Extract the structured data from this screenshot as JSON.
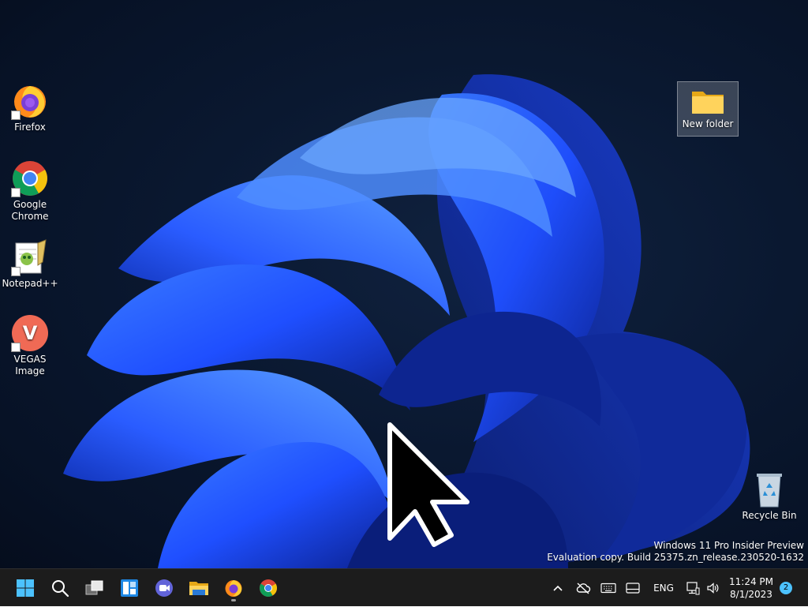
{
  "desktop": {
    "icons": [
      {
        "label": "Firefox",
        "icon": "firefox-icon"
      },
      {
        "label": "Google Chrome",
        "icon": "chrome-icon"
      },
      {
        "label": "Notepad++",
        "icon": "notepadpp-icon"
      },
      {
        "label": "VEGAS Image",
        "icon": "vegas-image-icon"
      },
      {
        "label": "New folder",
        "icon": "folder-icon"
      },
      {
        "label": "Recycle Bin",
        "icon": "recycle-bin-icon"
      }
    ],
    "watermark": {
      "line1": "Windows 11 Pro Insider Preview",
      "line2": "Evaluation copy. Build 25375.zn_release.230520-1632"
    }
  },
  "taskbar": {
    "apps": [
      {
        "name": "Start",
        "icon": "windows-start-icon"
      },
      {
        "name": "Search",
        "icon": "search-icon"
      },
      {
        "name": "Task View",
        "icon": "task-view-icon"
      },
      {
        "name": "Widgets",
        "icon": "widgets-icon"
      },
      {
        "name": "Chat",
        "icon": "chat-icon"
      },
      {
        "name": "File Explorer",
        "icon": "file-explorer-icon"
      },
      {
        "name": "Firefox",
        "icon": "firefox-icon",
        "running": true
      },
      {
        "name": "Google Chrome",
        "icon": "chrome-icon"
      }
    ],
    "tray": {
      "chevron_icon": "chevron-up-icon",
      "language": "ENG",
      "time": "11:24 PM",
      "date": "8/1/2023",
      "notification_count": "2"
    }
  },
  "colors": {
    "taskbar_bg": "#1c1c1c",
    "accent": "#4cc2ff",
    "wallpaper_blue": "#1f4fff"
  }
}
